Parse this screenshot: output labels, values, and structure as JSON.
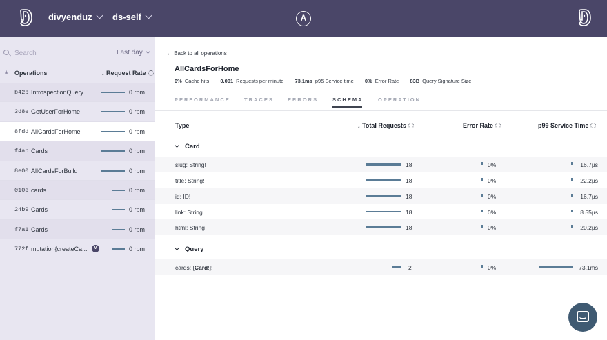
{
  "topbar": {
    "org_name": "divyenduz",
    "graph_name": "ds-self",
    "center_logo_text": "A"
  },
  "sidebar": {
    "search_placeholder": "Search",
    "time_range": "Last day",
    "ops_header": "Operations",
    "rate_header": "↓ Request Rate",
    "operations": [
      {
        "sig": "b42b",
        "name": "IntrospectionQuery",
        "rate": "0 rpm"
      },
      {
        "sig": "3d8e",
        "name": "GetUserForHome",
        "rate": "0 rpm"
      },
      {
        "sig": "8fdd",
        "name": "AllCardsForHome",
        "rate": "0 rpm"
      },
      {
        "sig": "f4ab",
        "name": "Cards",
        "rate": "0 rpm"
      },
      {
        "sig": "8e00",
        "name": "AllCardsForBuild",
        "rate": "0 rpm"
      },
      {
        "sig": "010e",
        "name": "cards",
        "rate": "0 rpm"
      },
      {
        "sig": "24b9",
        "name": "Cards",
        "rate": "0 rpm"
      },
      {
        "sig": "f7a1",
        "name": "Cards",
        "rate": "0 rpm"
      },
      {
        "sig": "772f",
        "name": "mutation{createCa...",
        "rate": "0 rpm",
        "badge": "M"
      }
    ]
  },
  "main": {
    "back_link": "← Back to all operations",
    "title": "AllCardsForHome",
    "stats": [
      {
        "value": "0%",
        "label": "Cache hits"
      },
      {
        "value": "0.001",
        "label": "Requests per minute"
      },
      {
        "value": "73.1ms",
        "label": "p95 Service time"
      },
      {
        "value": "0%",
        "label": "Error Rate"
      },
      {
        "value": "83B",
        "label": "Query Signature Size"
      }
    ],
    "tabs": [
      "PERFORMANCE",
      "TRACES",
      "ERRORS",
      "SCHEMA",
      "OPERATION"
    ],
    "active_tab": "SCHEMA",
    "columns": {
      "type": "Type",
      "total_requests": "↓ Total Requests",
      "error_rate": "Error Rate",
      "p99": "p99 Service Time"
    },
    "groups": [
      {
        "name": "Card",
        "fields": [
          {
            "field": "slug: String!",
            "requests": "18",
            "error_rate": "0%",
            "p99": "16.7µs"
          },
          {
            "field": "title: String!",
            "requests": "18",
            "error_rate": "0%",
            "p99": "22.2µs"
          },
          {
            "field": "id: ID!",
            "requests": "18",
            "error_rate": "0%",
            "p99": "16.7µs"
          },
          {
            "field": "link: String",
            "requests": "18",
            "error_rate": "0%",
            "p99": "8.55µs"
          },
          {
            "field": "html: String",
            "requests": "18",
            "error_rate": "0%",
            "p99": "20.2µs"
          }
        ]
      },
      {
        "name": "Query",
        "fields": [
          {
            "field_prefix": "cards: [",
            "field_bold": "Card",
            "field_suffix": "!]!",
            "requests": "2",
            "error_rate": "0%",
            "p99": "73.1ms"
          }
        ]
      }
    ]
  },
  "colors": {
    "topbar": "#4a4668",
    "sidebar": "#e8e6f1",
    "bar": "#5b7c96",
    "chat_button": "#3f5a72"
  }
}
